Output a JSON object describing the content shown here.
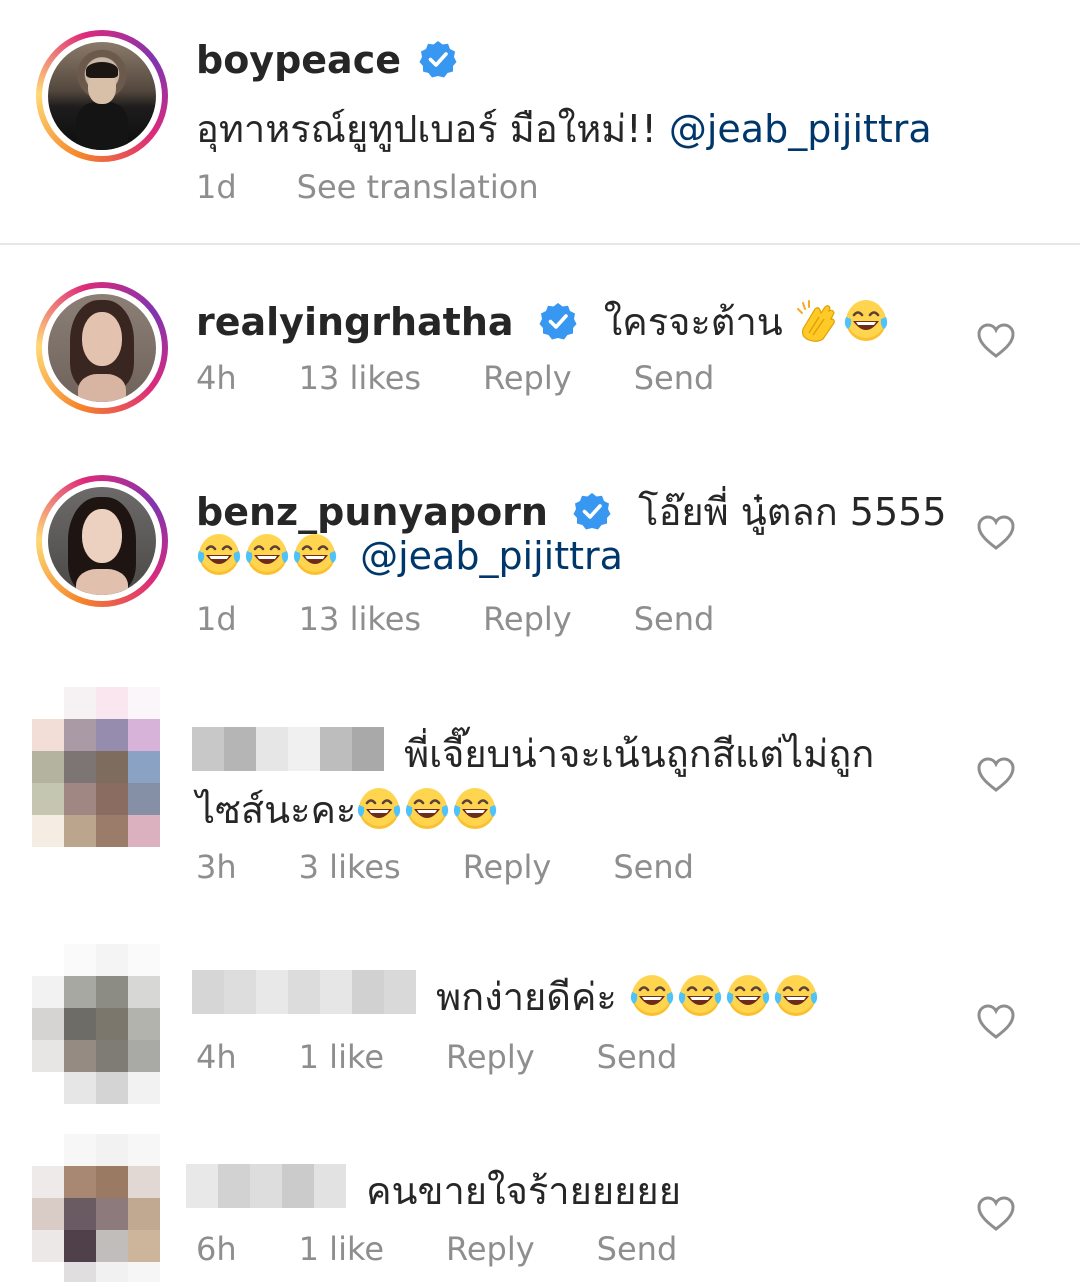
{
  "post": {
    "username": "boypeace",
    "verified": true,
    "caption_text": "อุทาหรณ์ยูทูปเบอร์ มือใหม่!! ",
    "caption_mention": "@jeab_pijittra",
    "time": "1d",
    "see_translation": "See translation"
  },
  "comments": [
    {
      "username": "realyingrhatha",
      "verified": true,
      "text": "ใครจะต้าน",
      "emojis": [
        "clapping-hands",
        "laughing-tears"
      ],
      "time": "4h",
      "likes": "13 likes",
      "reply": "Reply",
      "send": "Send"
    },
    {
      "username": "benz_punyaporn",
      "verified": true,
      "text": "โอ๊ยพี่ นู๋ตลก 5555",
      "emojis": [
        "laughing-tears",
        "laughing-tears",
        "laughing-tears"
      ],
      "mention": "@jeab_pijittra",
      "time": "1d",
      "likes": "13 likes",
      "reply": "Reply",
      "send": "Send"
    },
    {
      "username_blurred": true,
      "text_line1": "พี่เจี๊ยบน่าจะเน้นถูกสีแต่ไม่ถูก",
      "text_line2": "ไซส์นะคะ",
      "emojis": [
        "laughing-tears",
        "laughing-tears",
        "laughing-tears"
      ],
      "time": "3h",
      "likes": "3 likes",
      "reply": "Reply",
      "send": "Send"
    },
    {
      "username_blurred": true,
      "text": "พกง่ายดีค่ะ",
      "emojis": [
        "laughing-tears",
        "laughing-tears",
        "laughing-tears",
        "laughing-tears"
      ],
      "time": "4h",
      "likes": "1 like",
      "reply": "Reply",
      "send": "Send"
    },
    {
      "username_blurred": true,
      "text": "คนขายใจร้ายยยยย",
      "time": "6h",
      "likes": "1 like",
      "reply": "Reply",
      "send": "Send"
    }
  ],
  "colors": {
    "text": "#262626",
    "muted": "#8e8e8e",
    "mention": "#00376b",
    "verified": "#3897f0"
  }
}
